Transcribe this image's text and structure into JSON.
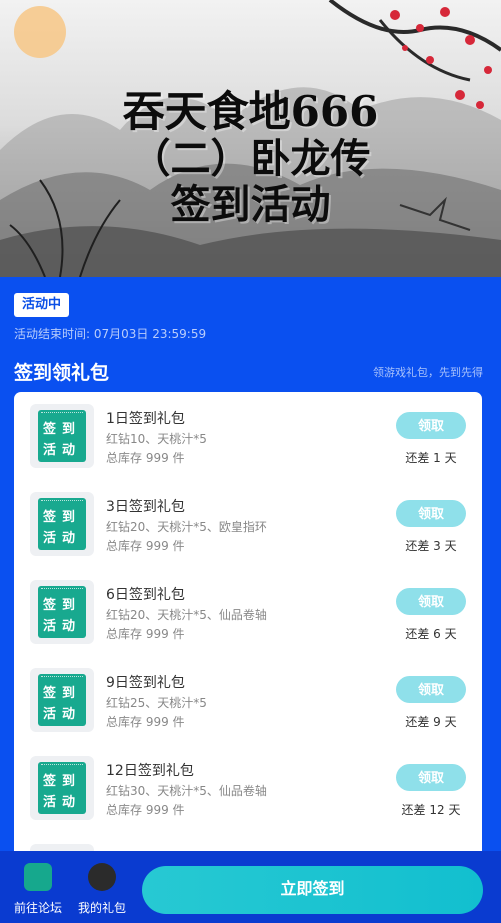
{
  "banner": {
    "title_line1": "吞天食地666",
    "title_line2": "（二）卧龙传",
    "title_line3": "签到活动"
  },
  "status": {
    "badge": "活动中",
    "end_time": "活动结束时间: 07月03日 23:59:59"
  },
  "section": {
    "title": "签到领礼包",
    "subtitle": "领游戏礼包，先到先得"
  },
  "thumb_text": [
    "签",
    "到",
    "活",
    "动"
  ],
  "gifts": [
    {
      "title": "1日签到礼包",
      "items": "红钻10、天桃汁*5",
      "stock": "总库存 999 件",
      "button": "领取",
      "remain": "还差 1 天"
    },
    {
      "title": "3日签到礼包",
      "items": "红钻20、天桃汁*5、欧皇指环",
      "stock": "总库存 999 件",
      "button": "领取",
      "remain": "还差 3 天"
    },
    {
      "title": "6日签到礼包",
      "items": "红钻20、天桃汁*5、仙品卷轴",
      "stock": "总库存 999 件",
      "button": "领取",
      "remain": "还差 6 天"
    },
    {
      "title": "9日签到礼包",
      "items": "红钻25、天桃汁*5",
      "stock": "总库存 999 件",
      "button": "领取",
      "remain": "还差 9 天"
    },
    {
      "title": "12日签到礼包",
      "items": "红钻30、天桃汁*5、仙品卷轴",
      "stock": "总库存 999 件",
      "button": "领取",
      "remain": "还差 12 天"
    }
  ],
  "bottom": {
    "forum_label": "前往论坛",
    "gift_label": "我的礼包",
    "checkin_button": "立即签到"
  },
  "colors": {
    "page_bg": "#0a50f0",
    "bottom_bar": "#0a3bd0",
    "accent_teal": "#12bfcf",
    "claim_button": "#8fe0ea",
    "thumb_green": "#18a98f"
  }
}
